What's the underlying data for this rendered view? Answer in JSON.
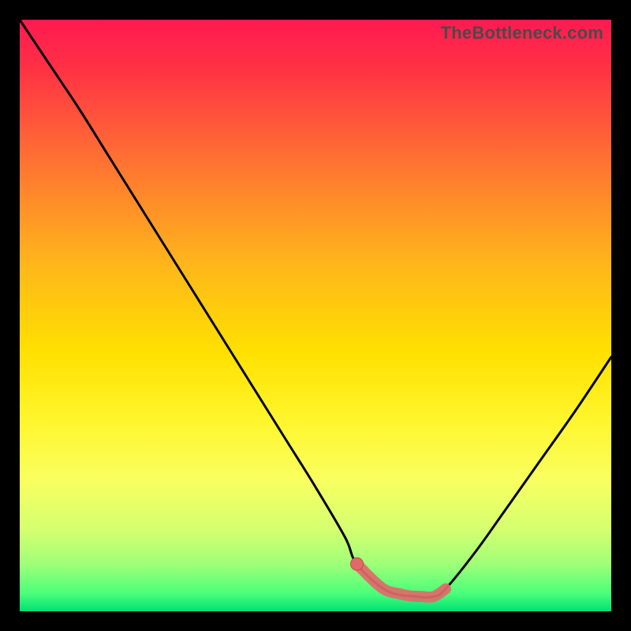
{
  "watermark": "TheBottleneck.com",
  "colors": {
    "background": "#000000",
    "curve": "#000000",
    "marker_fill": "#e06a6a",
    "marker_stroke": "#c24d4d"
  },
  "chart_data": {
    "type": "line",
    "title": "",
    "xlabel": "",
    "ylabel": "",
    "xlim": [
      0,
      100
    ],
    "ylim": [
      0,
      100
    ],
    "grid": false,
    "series": [
      {
        "name": "bottleneck-curve",
        "x": [
          0,
          5,
          10,
          15,
          20,
          25,
          30,
          35,
          40,
          45,
          50,
          55,
          57,
          62,
          67,
          70,
          72,
          77,
          82,
          88,
          94,
          100
        ],
        "values": [
          100,
          92.5,
          85,
          77,
          69,
          61,
          53,
          45,
          37,
          29,
          21,
          12.5,
          8,
          3.5,
          2.5,
          2.5,
          3.8,
          10,
          17,
          25.5,
          34,
          43
        ]
      }
    ],
    "highlighted_segment": {
      "name": "optimal-range",
      "x": [
        57,
        60,
        62,
        64,
        66,
        68,
        70,
        72
      ],
      "values": [
        8,
        5,
        3.5,
        3,
        2.6,
        2.5,
        2.5,
        3.8
      ]
    },
    "dot": {
      "x": 57,
      "y": 8
    }
  }
}
